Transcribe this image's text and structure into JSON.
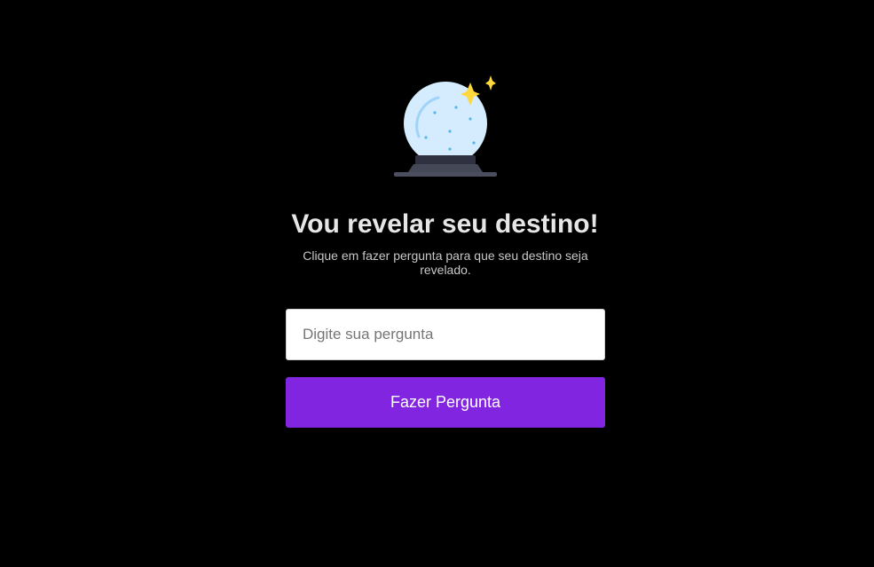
{
  "hero": {
    "icon": "crystal-ball-icon",
    "title": "Vou revelar seu destino!",
    "subtitle": "Clique em fazer pergunta para que seu destino seja revelado."
  },
  "form": {
    "question_placeholder": "Digite sua pergunta",
    "question_value": "",
    "ask_button_label": "Fazer Pergunta"
  },
  "colors": {
    "background": "#000000",
    "button": "#8225e0",
    "title_text": "#e6e6e6",
    "globe": "#d4ecfd",
    "base": "#3e4152",
    "sparkle": "#ffd93b"
  }
}
